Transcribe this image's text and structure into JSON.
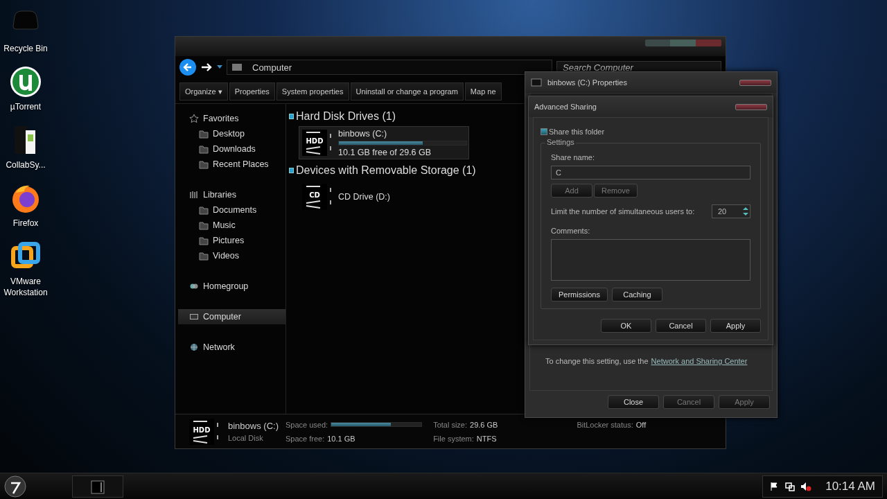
{
  "desktop_icons": [
    {
      "label": "Recycle Bin",
      "kind": "bin"
    },
    {
      "label": "µTorrent",
      "kind": "torrent"
    },
    {
      "label": "CollabSy...",
      "kind": "doc"
    },
    {
      "label": "Firefox",
      "kind": "firefox"
    },
    {
      "label": "VMware Workstation",
      "kind": "vmware"
    }
  ],
  "explorer": {
    "address": "Computer",
    "search": {
      "placeholder": "Search Computer"
    },
    "toolbar": [
      "Organize ▾",
      "Properties",
      "System properties",
      "Uninstall or change a program",
      "Map ne"
    ],
    "sidebar": [
      {
        "label": "Favorites",
        "kind": "star",
        "selected": false,
        "children": [
          {
            "label": "Desktop",
            "selected": false
          },
          {
            "label": "Downloads",
            "selected": false
          },
          {
            "label": "Recent Places",
            "selected": false
          }
        ]
      },
      {
        "label": "Libraries",
        "kind": "library",
        "selected": false,
        "children": [
          {
            "label": "Documents",
            "selected": false
          },
          {
            "label": "Music",
            "selected": false
          },
          {
            "label": "Pictures",
            "selected": false
          },
          {
            "label": "Videos",
            "selected": false
          }
        ]
      },
      {
        "label": "Homegroup",
        "kind": "homegroup",
        "selected": false
      },
      {
        "label": "Computer",
        "kind": "computer",
        "selected": true
      },
      {
        "label": "Network",
        "kind": "network",
        "selected": false
      }
    ],
    "groups": [
      {
        "title": "Hard Disk Drives (1)",
        "items": [
          {
            "name": "binbows (C:)",
            "badge": "HDD",
            "selected": true,
            "level": 0.66,
            "free": "10.1 GB free of 29.6 GB"
          }
        ]
      },
      {
        "title": "Devices with Removable Storage (1)",
        "items": [
          {
            "name": "CD Drive (D:)",
            "badge": "CD",
            "selected": false
          }
        ]
      }
    ],
    "details": {
      "badge": "HDD",
      "name": "binbows (C:)",
      "type": "Local Disk",
      "used_label": "Space used:",
      "level": 0.66,
      "free_label": "Space free:",
      "free": "10.1 GB",
      "total_label": "Total size:",
      "total": "29.6 GB",
      "fs_label": "File system:",
      "fs": "NTFS",
      "bitlocker_label": "BitLocker status:",
      "bitlocker": "Off"
    }
  },
  "properties_dialog": {
    "title": "binbows (C:) Properties",
    "note": "To change this setting, use the",
    "link": "Network and Sharing Center",
    "buttons": [
      {
        "label": "Close",
        "disabled": false
      },
      {
        "label": "Cancel",
        "disabled": true
      },
      {
        "label": "Apply",
        "disabled": true
      }
    ]
  },
  "advanced_sharing": {
    "title": "Advanced Sharing",
    "share": {
      "label": "Share this folder",
      "checked": true
    },
    "group": "Settings",
    "share_name_label": "Share name:",
    "share_name": "C",
    "name_buttons": [
      {
        "label": "Add",
        "disabled": true
      },
      {
        "label": "Remove",
        "disabled": true
      }
    ],
    "limit_label": "Limit the number of simultaneous users to:",
    "limit": "20",
    "comments_label": "Comments:",
    "setting_buttons": [
      "Permissions",
      "Caching"
    ],
    "buttons": [
      {
        "label": "OK",
        "disabled": false
      },
      {
        "label": "Cancel",
        "disabled": false
      },
      {
        "label": "Apply",
        "disabled": false
      }
    ]
  },
  "taskbar": {
    "clock": "10:14 AM"
  }
}
